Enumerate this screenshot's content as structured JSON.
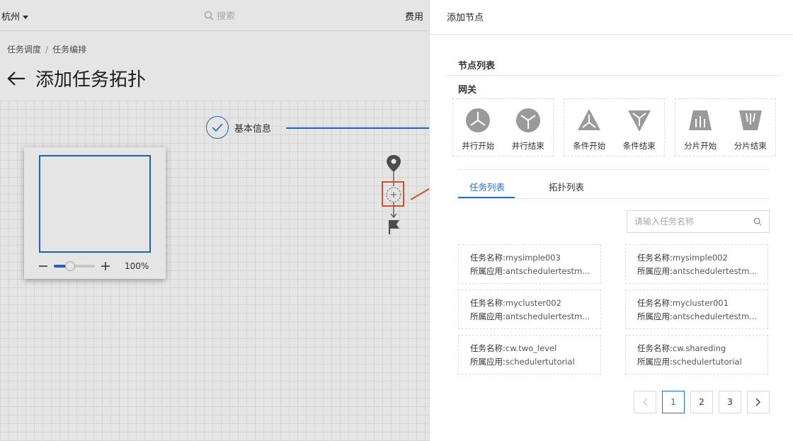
{
  "topbar": {
    "region": "杭州",
    "search_placeholder": "搜索",
    "fee": "费用"
  },
  "breadcrumb": [
    "任务调度",
    "任务编排"
  ],
  "page": {
    "title": "添加任务拓扑"
  },
  "step": {
    "label": "基本信息"
  },
  "minimap": {
    "zoom": "100%",
    "zoom_level": 0.4
  },
  "drawer": {
    "title": "添加节点",
    "section_title": "节点列表",
    "gateway_title": "网关",
    "gateways": [
      {
        "label": "并行开始",
        "icon": "parallel-start-icon"
      },
      {
        "label": "并行结束",
        "icon": "parallel-end-icon"
      },
      {
        "label": "条件开始",
        "icon": "condition-start-icon"
      },
      {
        "label": "条件结束",
        "icon": "condition-end-icon"
      },
      {
        "label": "分片开始",
        "icon": "shard-start-icon"
      },
      {
        "label": "分片结束",
        "icon": "shard-end-icon"
      }
    ],
    "tabs": [
      {
        "label": "任务列表",
        "active": true
      },
      {
        "label": "拓扑列表",
        "active": false
      }
    ],
    "search_placeholder": "请输入任务名称",
    "task_name_key": "任务名称:",
    "task_app_key": "所属应用:",
    "tasks": [
      {
        "name": "mysimple003",
        "app": "antschedulertestm..."
      },
      {
        "name": "mysimple002",
        "app": "antschedulertestm..."
      },
      {
        "name": "mycluster002",
        "app": "antschedulertestm..."
      },
      {
        "name": "mycluster001",
        "app": "antschedulertestm..."
      },
      {
        "name": "cw.two_level",
        "app": "schedulertutorial"
      },
      {
        "name": "cw.shareding",
        "app": "schedulertutorial"
      }
    ],
    "pagination": {
      "prev": "<",
      "pages": [
        "1",
        "2",
        "3"
      ],
      "current": "1",
      "next": ">"
    }
  },
  "colors": {
    "accent": "#1f6fd1",
    "callout": "#f05a28",
    "icon_gray": "#9a9a9a"
  }
}
